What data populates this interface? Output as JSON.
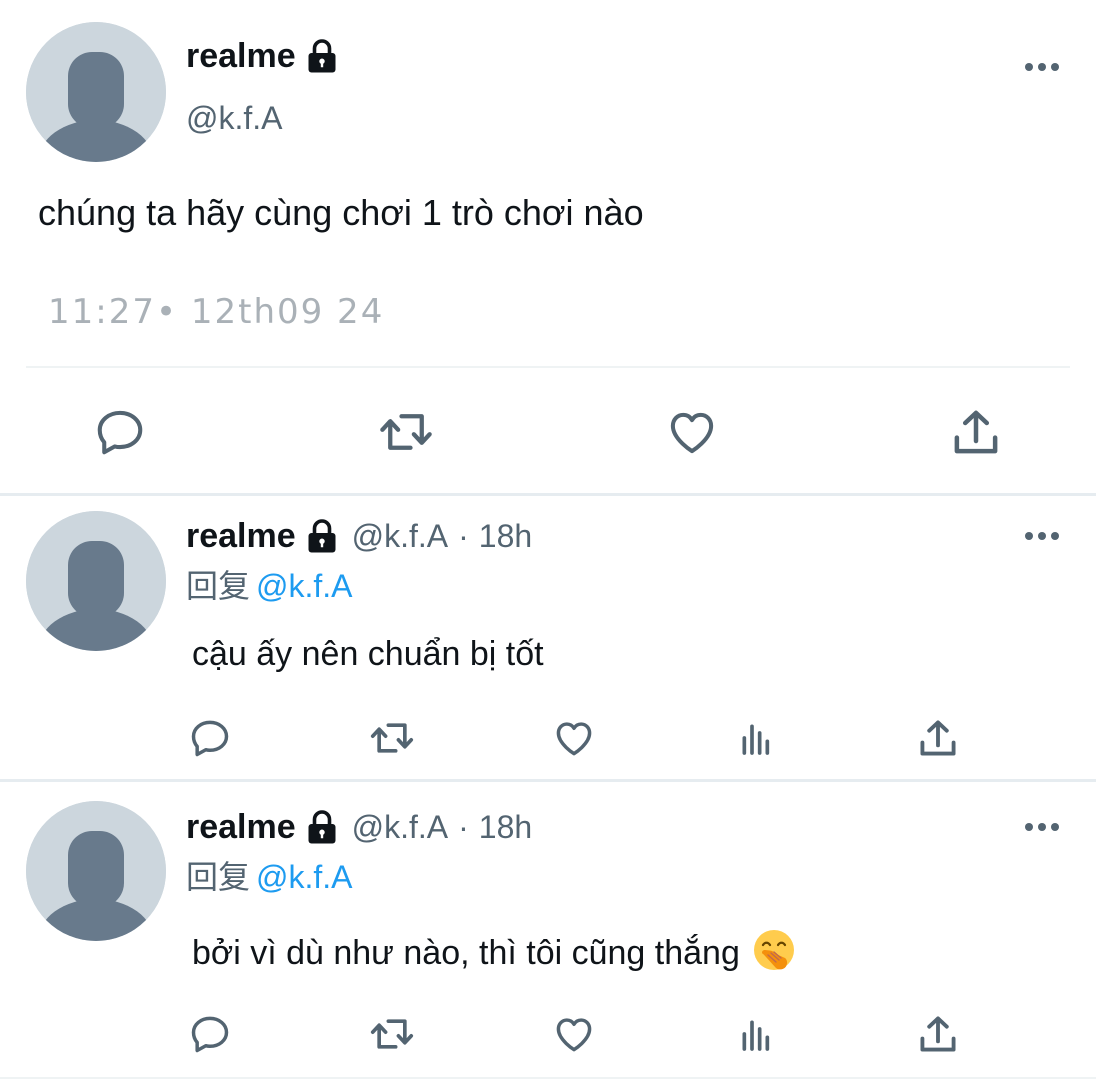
{
  "main_tweet": {
    "name": "realme",
    "handle": "@k.f.A",
    "text": "chúng ta hãy cùng chơi 1 trò chơi nào",
    "timestamp": "11:27• 12th09 24",
    "icons": [
      "lock-icon",
      "more-icon",
      "reply-icon",
      "retweet-icon",
      "like-icon",
      "share-icon"
    ]
  },
  "replies": [
    {
      "name": "realme",
      "handle": "@k.f.A",
      "time": "18h",
      "separator": "·",
      "reply_label": "回复",
      "reply_to": "@k.f.A",
      "text": "cậu ấy nên chuẩn bị tốt"
    },
    {
      "name": "realme",
      "handle": "@k.f.A",
      "time": "18h",
      "separator": "·",
      "reply_label": "回复",
      "reply_to": "@k.f.A",
      "text": "bởi vì dù như nào, thì tôi cũng thắng",
      "emoji": "face-with-hand-over-mouth"
    }
  ],
  "colors": {
    "text": "#0f1419",
    "secondary": "#536471",
    "link": "#1d9bf0",
    "timestamp": "#aab1b7",
    "avatar_bg": "#ccd6dd",
    "avatar_fg": "#687a8c"
  }
}
